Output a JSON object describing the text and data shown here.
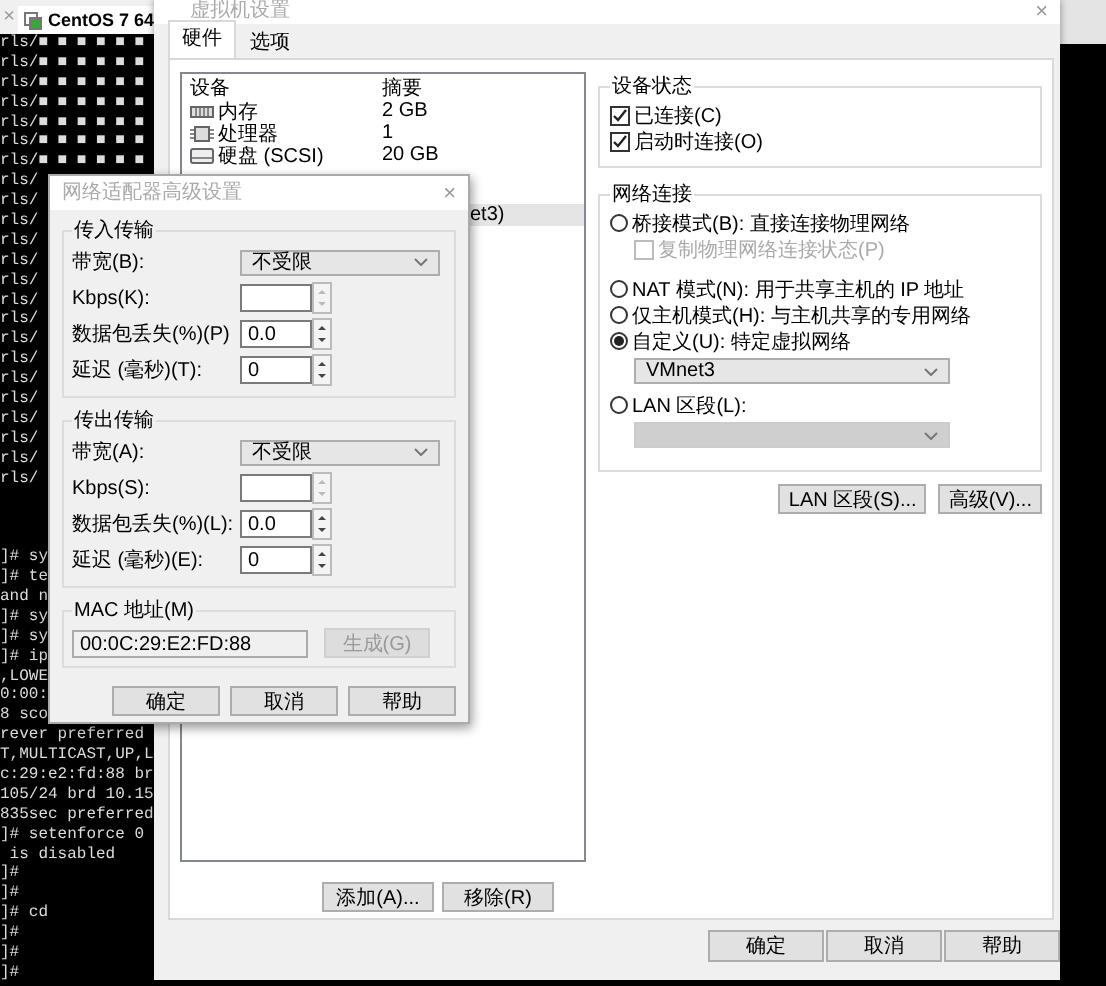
{
  "terminal": {
    "tab_close": "×",
    "tab_title": "CentOS 7 64",
    "blocks": [
      [
        "rls/■ ■ ■ ■ ■ ■",
        "rls/■ ■ ■ ■ ■ ■",
        "rls/■ ■ ■ ■ ■ ■",
        "rls/■ ■ ■ ■ ■ ■",
        "rls/■ ■ ■ ■ ■ ■",
        "rls/■ ■ ■ ■ ■ ■",
        "rls/■ ■ ■ ■ ■ ■",
        "rls/",
        "rls/",
        "rls/",
        "rls/",
        "rls/",
        "rls/",
        "rls/",
        "rls/",
        "rls/",
        "rls/",
        "rls/",
        "rls/",
        "rls/",
        "rls/",
        "rls/",
        "rls/"
      ],
      [
        "]# sy",
        "]# te",
        "and n",
        "]# sy",
        "]# sy",
        "]# ip",
        ",LOWE",
        "0:00:",
        "8 sco",
        "rever preferred",
        "T,MULTICAST,UP,L",
        "c:29:e2:fd:88 br",
        "105/24 brd 10.15",
        "835sec preferred",
        "]# setenforce 0",
        " is disabled",
        "]#",
        "]#",
        "]# cd",
        "]#",
        "]#",
        "]#"
      ]
    ]
  },
  "vm_settings": {
    "title": "虚拟机设置",
    "close": "×",
    "tabs": [
      {
        "label": "硬件",
        "selected": true
      },
      {
        "label": "选项",
        "selected": false
      }
    ],
    "device_table": {
      "columns": [
        "设备",
        "摘要"
      ],
      "rows": [
        {
          "device": "内存",
          "summary": "2 GB",
          "selected": false
        },
        {
          "device": "处理器",
          "summary": "1",
          "selected": false
        },
        {
          "device": "硬盘 (SCSI)",
          "summary": "20 GB",
          "selected": false
        }
      ],
      "partial_row": {
        "summary": "et3)",
        "selected": true
      }
    },
    "list_buttons": [
      "添加(A)...",
      "移除(R)"
    ],
    "device_status": {
      "title": "设备状态",
      "options": [
        {
          "label": "已连接(C)",
          "checked": true
        },
        {
          "label": "启动时连接(O)",
          "checked": true
        }
      ]
    },
    "network_connection": {
      "title": "网络连接",
      "items": [
        {
          "kind": "radio",
          "label": "桥接模式(B): 直接连接物理网络",
          "selected": false
        },
        {
          "kind": "checkbox",
          "label": "复制物理网络连接状态(P)",
          "checked": false,
          "disabled": true
        },
        {
          "kind": "radio",
          "label": "NAT 模式(N): 用于共享主机的 IP 地址",
          "selected": false
        },
        {
          "kind": "radio",
          "label": "仅主机模式(H): 与主机共享的专用网络",
          "selected": false
        },
        {
          "kind": "radio",
          "label": "自定义(U): 特定虚拟网络",
          "selected": true
        },
        {
          "kind": "dropdown",
          "value": "VMnet3",
          "disabled": false
        },
        {
          "kind": "radio",
          "label": "LAN 区段(L):",
          "selected": false
        },
        {
          "kind": "dropdown",
          "disabled": true
        }
      ]
    },
    "network_buttons": [
      "LAN 区段(S)...",
      "高级(V)..."
    ],
    "footer_buttons": [
      "确定",
      "取消",
      "帮助"
    ]
  },
  "adapter_advanced": {
    "title": "网络适配器高级设置",
    "close": "×",
    "groups": [
      {
        "title": "传入传输",
        "fields": [
          {
            "kind": "dropdown",
            "label": "带宽(B):",
            "value": "不受限"
          },
          {
            "kind": "spinner",
            "label": "Kbps(K):",
            "disabled": true
          },
          {
            "kind": "spinner",
            "label": "数据包丢失(%)(P)",
            "value": "0.0",
            "disabled": false
          },
          {
            "kind": "spinner",
            "label": "延迟 (毫秒)(T):",
            "value": "0",
            "disabled": false
          }
        ]
      },
      {
        "title": "传出传输",
        "fields": [
          {
            "kind": "dropdown",
            "label": "带宽(A):",
            "value": "不受限"
          },
          {
            "kind": "spinner",
            "label": "Kbps(S):",
            "disabled": true
          },
          {
            "kind": "spinner",
            "label": "数据包丢失(%)(L):",
            "value": "0.0",
            "disabled": false
          },
          {
            "kind": "spinner",
            "label": "延迟 (毫秒)(E):",
            "value": "0",
            "disabled": false
          }
        ]
      }
    ],
    "mac": {
      "title": "MAC 地址(M)",
      "value": "00:0C:29:E2:FD:88",
      "button": "生成(G)",
      "button_disabled": true
    },
    "buttons": [
      "确定",
      "取消",
      "帮助"
    ]
  }
}
